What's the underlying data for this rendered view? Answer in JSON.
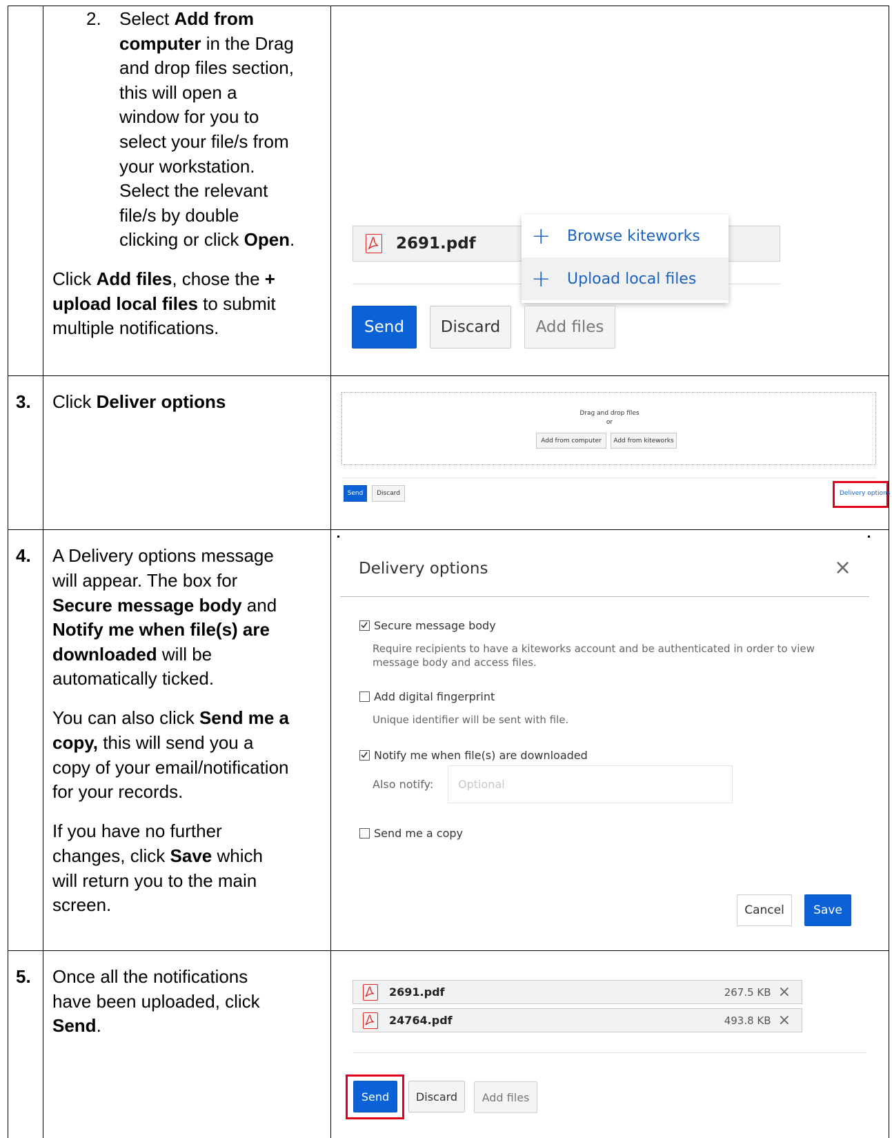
{
  "row_top": {
    "step2_number": "2.",
    "step2_text_a": "Select ",
    "step2_bold_a": "Add from",
    "step2_bold_b": "computer",
    "step2_text_b": " in the Drag",
    "step2_lines": [
      "and drop files section,",
      "this will open a",
      "window for you to",
      "select your file/s from",
      "your workstation.",
      "Select the relevant",
      "file/s by double"
    ],
    "step2_last_a": "clicking or click ",
    "step2_last_bold": "Open",
    "step2_last_b": ".",
    "para_a": "Click ",
    "para_bold_a": "Add files",
    "para_b": ", chose the ",
    "para_bold_b": "+",
    "para_bold_c": "upload local files",
    "para_c": " to submit",
    "para_d": "multiple notifications.",
    "screenshot": {
      "file_name": "2691.pdf",
      "menu_browse": "Browse kiteworks",
      "menu_upload": "Upload local files",
      "send": "Send",
      "discard": "Discard",
      "add_files": "Add files"
    }
  },
  "row3": {
    "number": "3.",
    "text_a": "Click ",
    "text_bold": "Deliver options",
    "screenshot": {
      "drag_drop": "Drag and drop files",
      "or": "or",
      "add_from_computer": "Add from computer",
      "add_from_kiteworks": "Add from kiteworks",
      "send": "Send",
      "discard": "Discard",
      "delivery_options": "Delivery options"
    }
  },
  "row4": {
    "number": "4.",
    "p1_a": "A Delivery options message",
    "p1_b": "will appear. The box for",
    "p1_bold_a": "Secure message body",
    "p1_c": " and",
    "p1_bold_b": "Notify me when file(s) are",
    "p1_bold_c": "downloaded",
    "p1_d": " will be",
    "p1_e": "automatically ticked.",
    "p2_a": "You can also click ",
    "p2_bold_a": "Send me a",
    "p2_bold_b": "copy,",
    "p2_b": " this will send you a",
    "p2_c": "copy of your email/notification",
    "p2_d": "for your records.",
    "p3_a": "If you have no further",
    "p3_b": "changes, click ",
    "p3_bold": "Save",
    "p3_c": " which",
    "p3_d": "will return you to the main",
    "p3_e": "screen.",
    "dialog": {
      "title": "Delivery options",
      "close": "×",
      "opt1_label": "Secure message body",
      "opt1_desc_a": "Require recipients to have a kiteworks account and be authenticated in order to view",
      "opt1_desc_b": "message body and access files.",
      "opt1_checked": true,
      "opt2_label": "Add digital fingerprint",
      "opt2_desc": "Unique identifier will be sent with file.",
      "opt2_checked": false,
      "opt3_label": "Notify me when file(s) are downloaded",
      "opt3_checked": true,
      "also_notify_label": "Also notify:",
      "also_notify_placeholder": "Optional",
      "opt4_label": "Send me a copy",
      "opt4_checked": false,
      "cancel": "Cancel",
      "save": "Save"
    }
  },
  "row5": {
    "number": "5.",
    "text_a": "Once all the notifications",
    "text_b": "have been uploaded, click",
    "text_bold": "Send",
    "text_c": ".",
    "screenshot": {
      "files": [
        {
          "name": "2691.pdf",
          "size": "267.5 KB"
        },
        {
          "name": "24764.pdf",
          "size": "493.8 KB"
        }
      ],
      "remove": "×",
      "send": "Send",
      "discard": "Discard",
      "add_files": "Add files"
    }
  }
}
